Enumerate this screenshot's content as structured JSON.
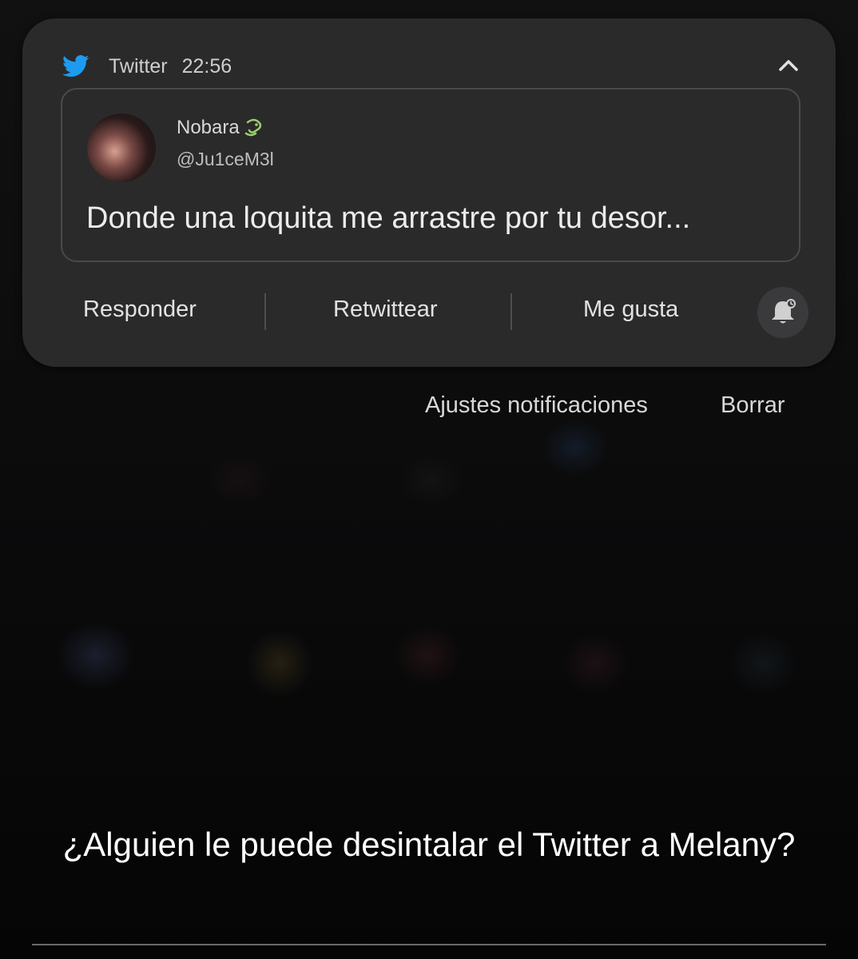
{
  "notification": {
    "app_icon": "twitter-bird-icon",
    "app_name": "Twitter",
    "time": "22:56",
    "collapse_icon": "chevron-up-icon",
    "tweet": {
      "display_name": "Nobara",
      "name_emoji": "emoji-icon",
      "handle": "@Ju1ceM3l",
      "text": "Donde una loquita me arrastre por tu desor..."
    },
    "actions": {
      "reply": "Responder",
      "retweet": "Retwittear",
      "like": "Me gusta",
      "snooze_icon": "bell-snooze-icon"
    }
  },
  "notification_controls": {
    "settings": "Ajustes notificaciones",
    "clear": "Borrar"
  },
  "caption": "¿Alguien le puede desintalar el Twitter a Melany?",
  "colors": {
    "twitter_blue": "#1d9bf0",
    "card_bg": "#2a2a2b",
    "background": "#000000"
  }
}
